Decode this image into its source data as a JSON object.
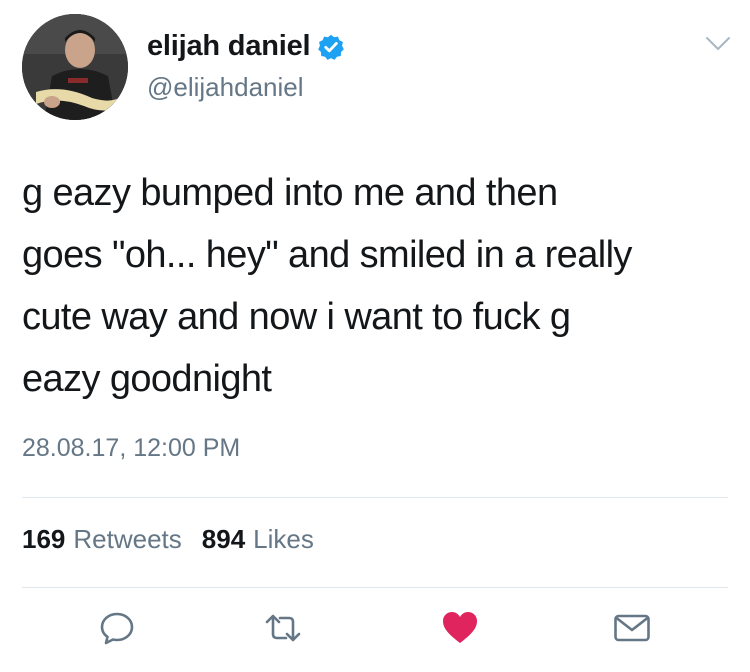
{
  "author": {
    "display_name": "elijah daniel",
    "handle": "@elijahdaniel",
    "verified": true
  },
  "tweet": {
    "text": "g eazy bumped into me and then\ngoes \"oh... hey\" and smiled in a really\ncute way and now i want to fuck g\neazy goodnight",
    "timestamp": "28.08.17, 12:00 PM"
  },
  "stats": {
    "retweets_count": "169",
    "retweets_label": "Retweets",
    "likes_count": "894",
    "likes_label": "Likes"
  },
  "colors": {
    "verified_badge": "#1da1f2",
    "like_active": "#e0245e",
    "secondary_text": "#657786",
    "divider": "#e1e8ed"
  },
  "icons": {
    "menu": "chevron-down-icon",
    "reply": "reply-icon",
    "retweet": "retweet-icon",
    "like": "heart-icon",
    "direct_message": "envelope-icon"
  },
  "state": {
    "liked": true
  }
}
